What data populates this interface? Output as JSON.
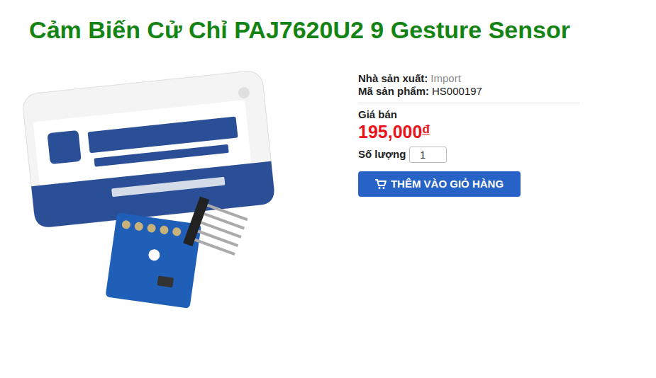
{
  "title": "Cảm Biến Cử Chỉ PAJ7620U2 9 Gesture Sensor",
  "product": {
    "manufacturer": {
      "label": "Nhà sản xuất:",
      "value": "Import"
    },
    "sku": {
      "label": "Mã sản phẩm:",
      "value": "HS000197"
    },
    "price": {
      "label": "Giá bán",
      "amount": "195,000",
      "currency": "đ"
    },
    "quantity": {
      "label": "Số lượng",
      "value": "1"
    },
    "add_to_cart": {
      "label": "THÊM VÀO GIỎ HÀNG"
    }
  }
}
